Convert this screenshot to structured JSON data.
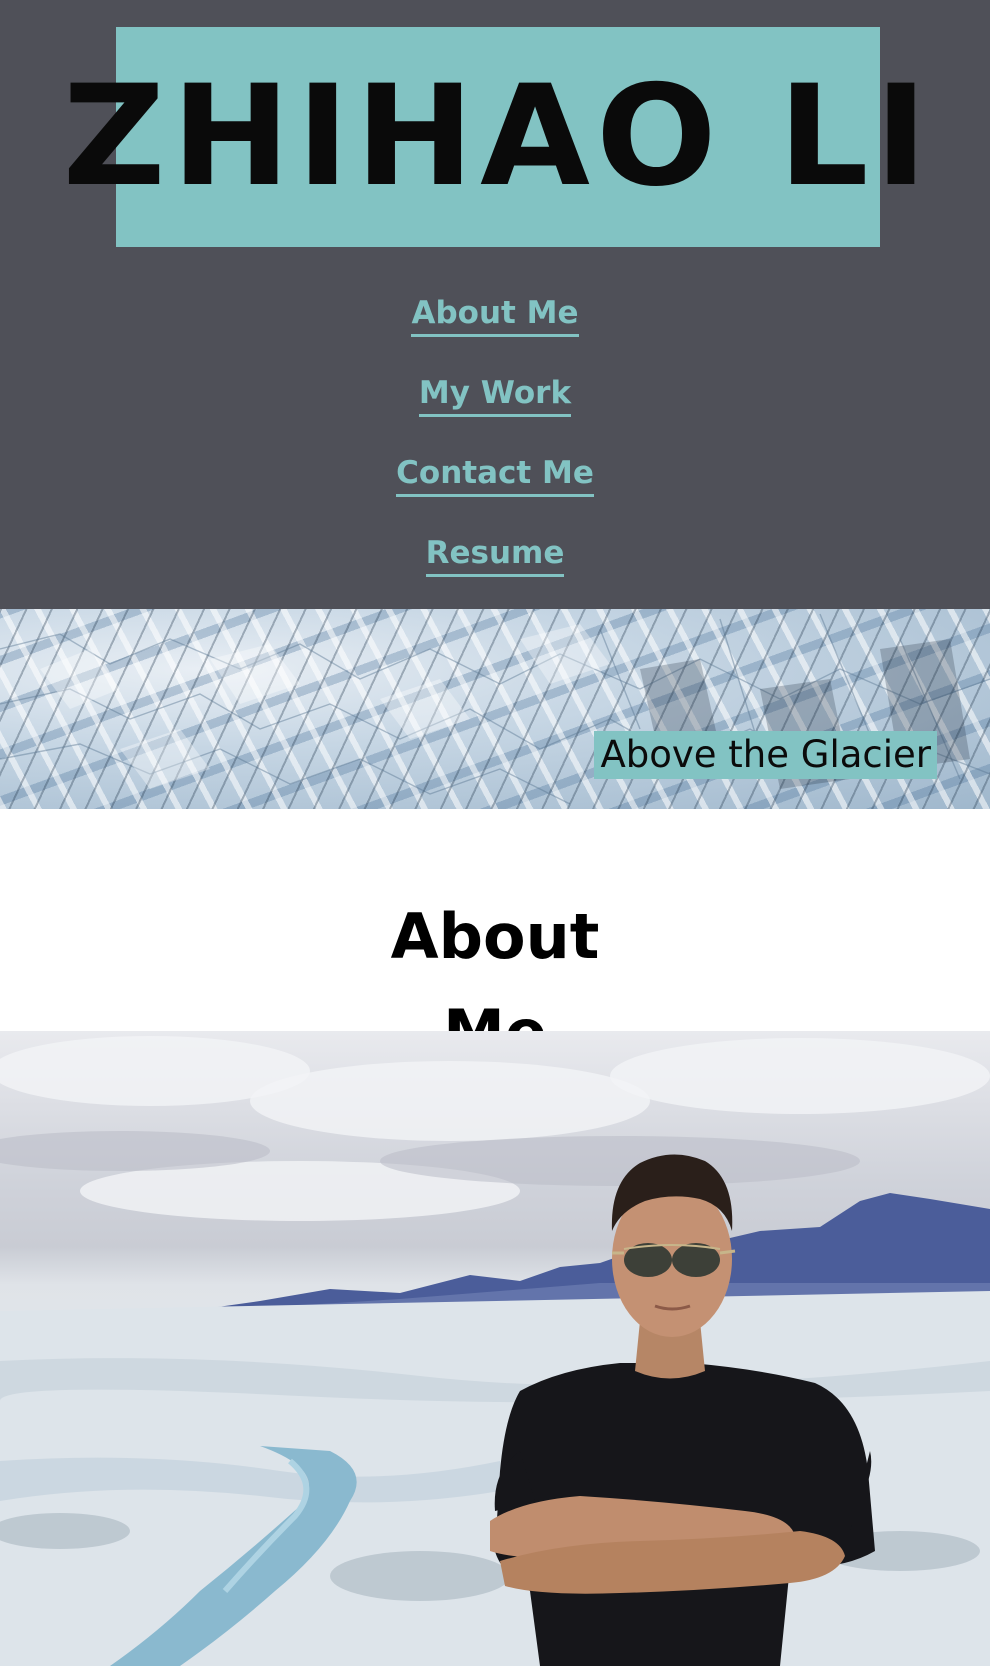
{
  "site": {
    "logo_text": "ZHIHAO LI"
  },
  "nav": {
    "items": [
      {
        "label": "About Me"
      },
      {
        "label": "My Work"
      },
      {
        "label": "Contact Me"
      },
      {
        "label": "Resume"
      }
    ]
  },
  "banner": {
    "caption": "Above the Glacier"
  },
  "about": {
    "heading_line1": "About",
    "heading_line2": "Me"
  },
  "colors": {
    "header_bg": "#4f5058",
    "accent": "#82c3c3",
    "text_dark": "#0a0a0a"
  }
}
